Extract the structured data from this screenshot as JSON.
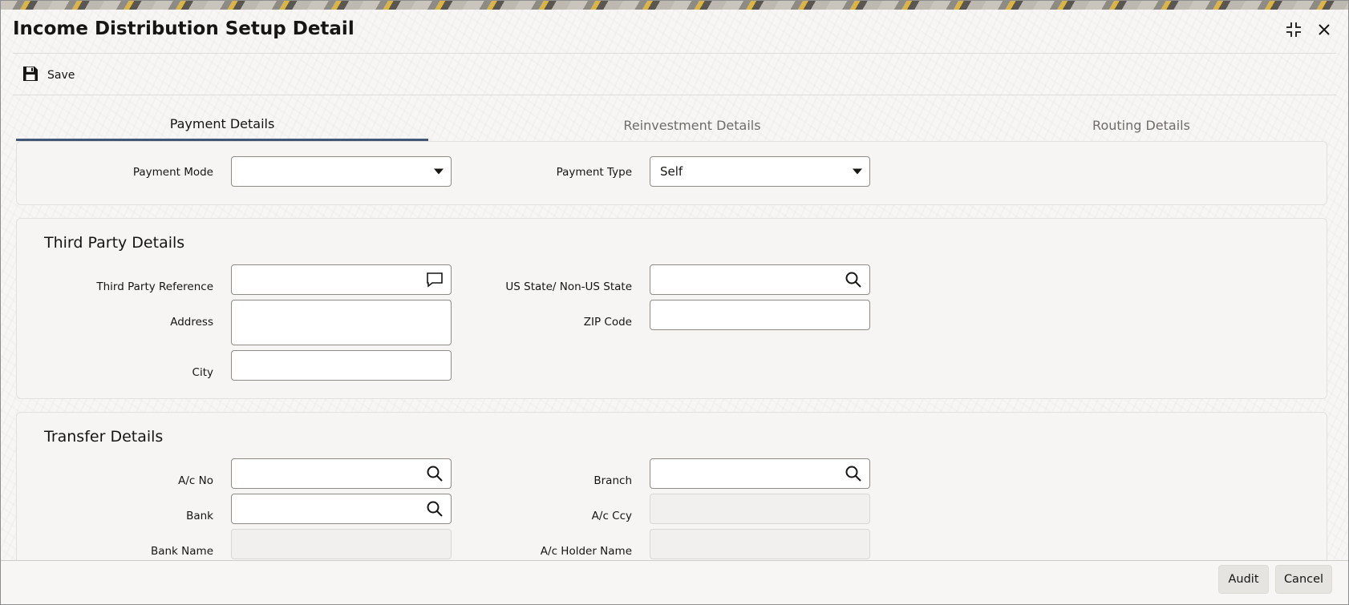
{
  "window": {
    "title": "Income Distribution Setup Detail",
    "maximize_icon": "maximize-icon",
    "close_icon": "close-icon"
  },
  "toolbar": {
    "save_label": "Save",
    "save_icon": "floppy-disk-icon"
  },
  "tabs": [
    {
      "label": "Payment Details",
      "active": true
    },
    {
      "label": "Reinvestment Details",
      "active": false
    },
    {
      "label": "Routing Details",
      "active": false
    }
  ],
  "payment": {
    "payment_mode_label": "Payment Mode",
    "payment_mode_value": "",
    "payment_type_label": "Payment Type",
    "payment_type_value": "Self"
  },
  "third_party": {
    "title": "Third Party Details",
    "reference_label": "Third Party Reference",
    "reference_value": "",
    "state_label": "US State/ Non-US State",
    "state_value": "",
    "address_label": "Address",
    "address_value": "",
    "zip_label": "ZIP Code",
    "zip_value": "",
    "city_label": "City",
    "city_value": ""
  },
  "transfer": {
    "title": "Transfer Details",
    "ac_no_label": "A/c No",
    "ac_no_value": "",
    "branch_label": "Branch",
    "branch_value": "",
    "bank_label": "Bank",
    "bank_value": "",
    "ac_ccy_label": "A/c Ccy",
    "ac_ccy_value": "",
    "bank_name_label": "Bank Name",
    "bank_name_value": "",
    "holder_name_label": "A/c Holder Name",
    "holder_name_value": ""
  },
  "footer": {
    "audit_label": "Audit",
    "cancel_label": "Cancel"
  }
}
